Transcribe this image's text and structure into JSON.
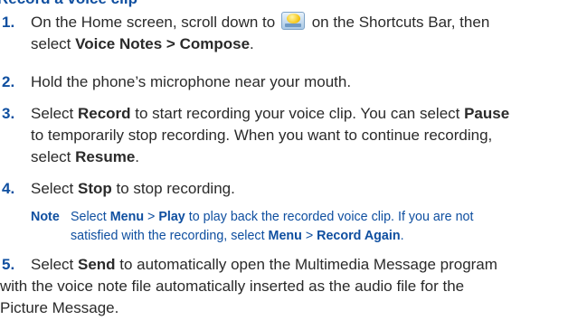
{
  "heading": "Record a voice clip",
  "steps": [
    {
      "number": "1.",
      "line1_a": "On the Home screen, scroll down to",
      "line1_b": "on the Shortcuts Bar, then",
      "line2_a": "select ",
      "line2_b": "Voice Notes > Compose",
      "line2_c": ".",
      "icon": "voice-notes-shortcut-icon"
    },
    {
      "number": "2.",
      "line1": "Hold the phone’s microphone near your mouth."
    },
    {
      "number": "3.",
      "line1_a": "Select ",
      "line1_b": "Record",
      "line1_c": " to start recording your voice clip. You can select ",
      "line1_d": "Pause",
      "line2": "to temporarily stop recording. When you want to continue recording,",
      "line3_a": "select ",
      "line3_b": "Resume",
      "line3_c": "."
    },
    {
      "number": "4.",
      "line1_a": "Select ",
      "line1_b": "Stop",
      "line1_c": " to stop recording."
    },
    {
      "number": "5.",
      "line1_a": "Select ",
      "line1_b": "Send",
      "line1_c": " to automatically open the Multimedia Message program",
      "line2": "with the voice note file automatically inserted as the audio file for the",
      "line3": "Picture Message."
    }
  ],
  "note": {
    "label": "Note",
    "line1_a": "Select ",
    "line1_b": "Menu",
    "line1_c": " > ",
    "line1_d": "Play",
    "line1_e": " to play back the recorded voice clip. If you are not",
    "line2_a": "satisfied with the recording, select ",
    "line2_b": "Menu",
    "line2_c": " > ",
    "line2_d": "Record Again",
    "line2_e": "."
  },
  "colors": {
    "accent": "#0f4fa0",
    "text": "#2a2a2a"
  }
}
